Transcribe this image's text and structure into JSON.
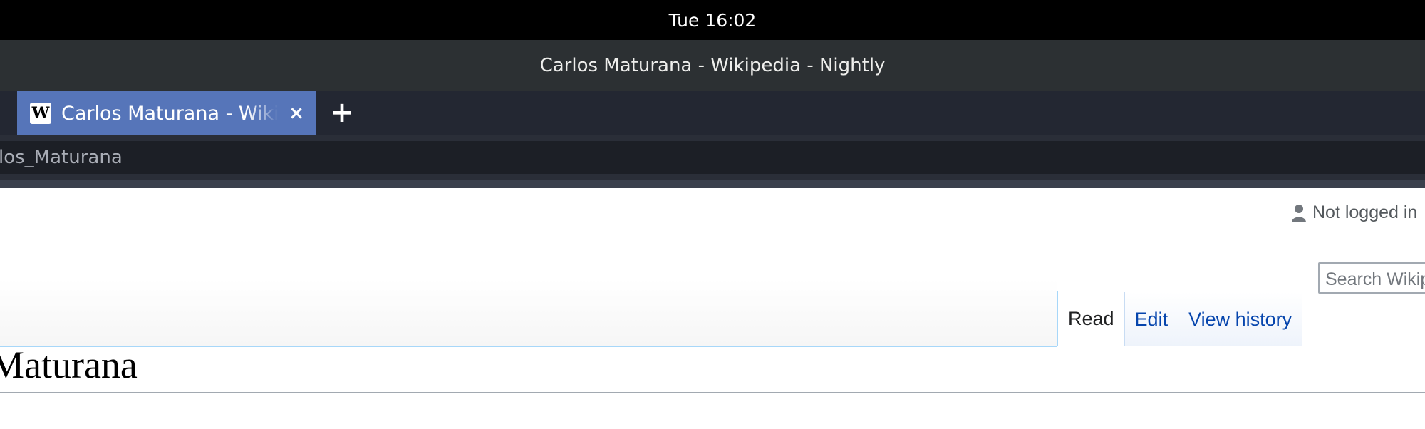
{
  "system": {
    "clock": "Tue 16:02"
  },
  "window": {
    "title": "Carlos Maturana - Wikipedia - Nightly"
  },
  "tabs": {
    "active": {
      "title": "Carlos Maturana - Wikipedia",
      "favicon": "W"
    },
    "close_symbol": "×",
    "new_tab_symbol": "+"
  },
  "urlbar": {
    "value": "los_Maturana"
  },
  "wiki": {
    "personal": {
      "not_logged_in": "Not logged in"
    },
    "views": [
      {
        "label": "Read"
      },
      {
        "label": "Edit"
      },
      {
        "label": "View history"
      }
    ],
    "search": {
      "placeholder": "Search Wikipedia"
    },
    "heading": "Maturana"
  },
  "colors": {
    "active_tab": "#5675b9",
    "link": "#0645ad",
    "tabstrip": "#232732"
  }
}
